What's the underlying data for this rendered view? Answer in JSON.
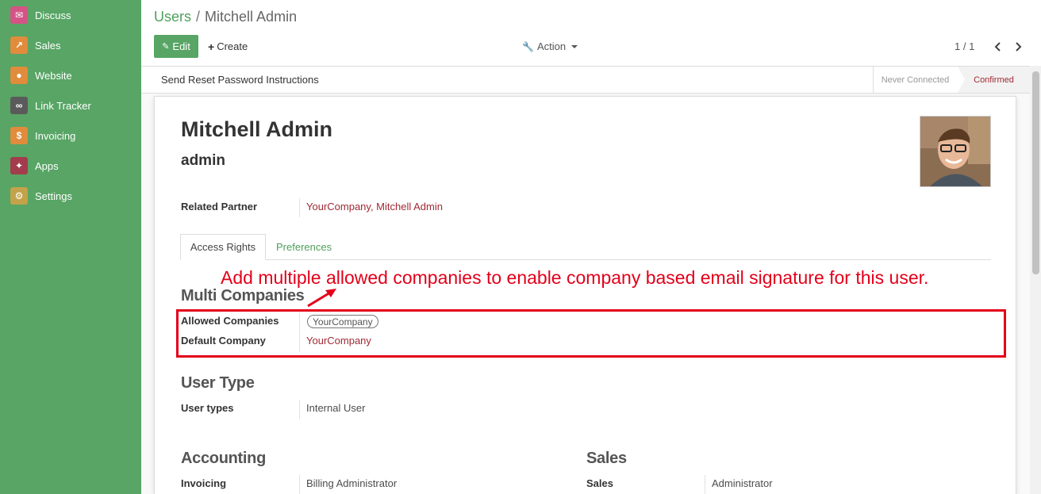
{
  "sidebar": {
    "items": [
      {
        "label": "Discuss",
        "color": "#d45486",
        "glyph": "✉"
      },
      {
        "label": "Sales",
        "color": "#e08c3c",
        "glyph": "↗"
      },
      {
        "label": "Website",
        "color": "#e08c3c",
        "glyph": "●"
      },
      {
        "label": "Link Tracker",
        "color": "#5a5a5a",
        "glyph": "∞"
      },
      {
        "label": "Invoicing",
        "color": "#e08c3c",
        "glyph": "$"
      },
      {
        "label": "Apps",
        "color": "#a33c4c",
        "glyph": "✦"
      },
      {
        "label": "Settings",
        "color": "#c2a34a",
        "glyph": "⚙"
      }
    ]
  },
  "breadcrumb": {
    "parent": "Users",
    "separator": "/",
    "current": "Mitchell Admin"
  },
  "toolbar": {
    "edit_label": "Edit",
    "create_label": "Create",
    "action_label": "Action"
  },
  "pager": {
    "value": "1 / 1"
  },
  "statusbar": {
    "reset_label": "Send Reset Password Instructions",
    "stages": [
      "Never Connected",
      "Confirmed"
    ],
    "active_stage": "Confirmed"
  },
  "user": {
    "name": "Mitchell Admin",
    "login": "admin"
  },
  "fields": {
    "related_partner": {
      "label": "Related Partner",
      "value": "YourCompany, Mitchell Admin"
    }
  },
  "tabs": [
    "Access Rights",
    "Preferences"
  ],
  "annotation": "Add multiple allowed companies to enable company based email signature for this user.",
  "multi_companies": {
    "title": "Multi Companies",
    "allowed_label": "Allowed Companies",
    "allowed_tag": "YourCompany",
    "default_label": "Default Company",
    "default_value": "YourCompany"
  },
  "user_type": {
    "title": "User Type",
    "label": "User types",
    "value": "Internal User"
  },
  "accounting": {
    "title": "Accounting",
    "label": "Invoicing",
    "value": "Billing Administrator"
  },
  "sales": {
    "title": "Sales",
    "label": "Sales",
    "value": "Administrator"
  },
  "colors": {
    "brand_green": "#58a565",
    "link_red": "#a02a34",
    "annotation_red": "#e3001a"
  }
}
